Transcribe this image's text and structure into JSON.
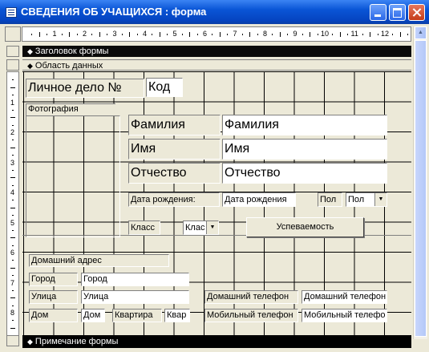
{
  "window": {
    "title": "СВЕДЕНИЯ ОБ УЧАЩИХСЯ : форма"
  },
  "ruler": {
    "numbers": [
      "1",
      "2",
      "3",
      "4",
      "5",
      "6",
      "7",
      "8",
      "9",
      "10",
      "11",
      "12"
    ]
  },
  "ruler_v": {
    "numbers": [
      "1",
      "2",
      "3",
      "4",
      "5",
      "6",
      "7",
      "8"
    ]
  },
  "sections": {
    "header": "Заголовок формы",
    "detail": "Область данных",
    "footer": "Примечание формы"
  },
  "form": {
    "lichnoe_label": "Личное дело №",
    "kod_field": "Код",
    "photo_label": "Фотография",
    "familiya_label": "Фамилия",
    "familiya_field": "Фамилия",
    "imya_label": "Имя",
    "imya_field": "Имя",
    "otchestvo_label": "Отчество",
    "otchestvo_field": "Отчество",
    "dob_label": "Дата рождения:",
    "dob_field": "Дата рождения",
    "pol_label": "Пол",
    "pol_combo": "Пол",
    "klass_label": "Класс",
    "klass_combo": "Клас",
    "uspevaemost_button": "Успеваемость",
    "address_label": "Домашний адрес",
    "gorod_label": "Город",
    "gorod_field": "Город",
    "ulitsa_label": "Улица",
    "ulitsa_field": "Улица",
    "dom_label": "Дом",
    "dom_field": "Дом",
    "kvartira_label": "Квартира",
    "kvartira_field": "Квар",
    "home_phone_label": "Домашний телефон",
    "home_phone_field": "Домашний телефон",
    "mobile_phone_label": "Мобильный телефон",
    "mobile_phone_field": "Мобильный телефо"
  }
}
